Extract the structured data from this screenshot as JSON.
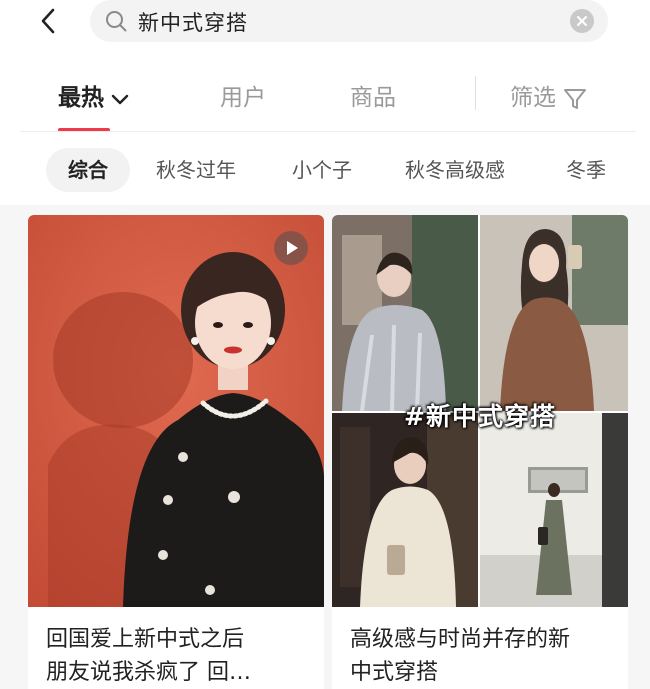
{
  "search": {
    "query": "新中式穿搭"
  },
  "tabs": {
    "hot": "最热",
    "user": "用户",
    "goods": "商品",
    "filter": "筛选"
  },
  "chips": [
    "综合",
    "秋冬过年",
    "小个子",
    "秋冬高级感",
    "冬季"
  ],
  "feed": {
    "cards": [
      {
        "title": "回国爱上新中式之后\n朋友说我杀疯了 回…",
        "has_video": true
      },
      {
        "title": "高级感与时尚并存的新\n中式穿搭",
        "image_tag": "#新中式穿搭"
      }
    ]
  },
  "colors": {
    "accent": "#ee3a4a",
    "cover_red": "#d65a42"
  },
  "icons": [
    "back-arrow-icon",
    "search-icon",
    "clear-icon",
    "chevron-down-icon",
    "filter-icon",
    "play-icon"
  ]
}
